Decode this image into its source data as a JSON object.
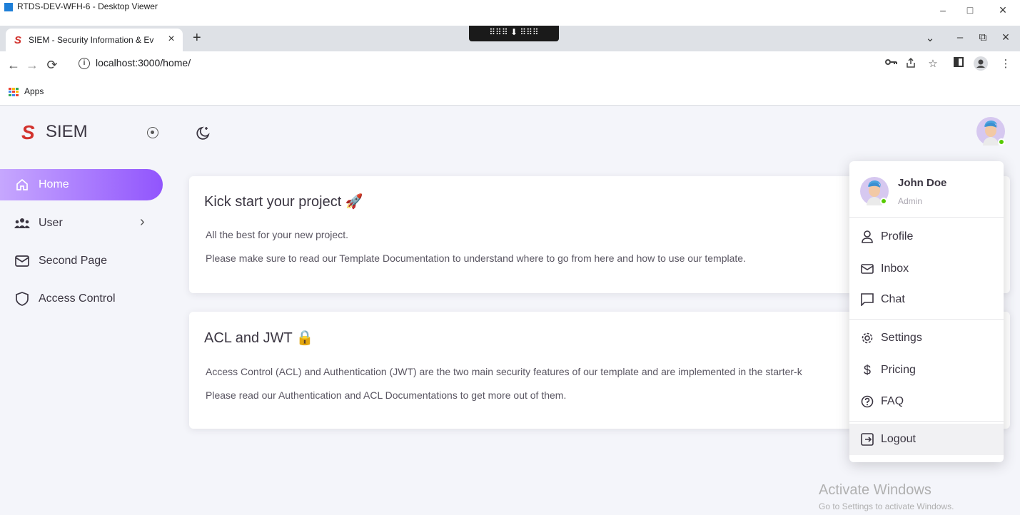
{
  "window": {
    "title": "RTDS-DEV-WFH-6 - Desktop Viewer",
    "minimize": "–",
    "maximize": "□",
    "close": "×"
  },
  "browser": {
    "tab_title": "SIEM - Security Information & Ev",
    "tab_close": "×",
    "new_tab": "+",
    "remote_bar": "⠿⠿⠿ ⬇ ⠿⠿⠿",
    "url": "localhost:3000/home/",
    "bookmark_apps": "Apps",
    "tab_dropdown": "⌄",
    "minimize": "–",
    "restore": "⧉",
    "close": "×"
  },
  "app": {
    "logo": "S",
    "name": "SIEM"
  },
  "sidebar": {
    "items": [
      {
        "label": "Home",
        "icon": "home-icon",
        "active": true
      },
      {
        "label": "User",
        "icon": "users-icon",
        "chevron": "›"
      },
      {
        "label": "Second Page",
        "icon": "mail-icon"
      },
      {
        "label": "Access Control",
        "icon": "shield-icon"
      }
    ]
  },
  "cards": [
    {
      "title": "Kick start your project 🚀",
      "lines": [
        "All the best for your new project.",
        "Please make sure to read our Template Documentation to understand where to go from here and how to use our template."
      ]
    },
    {
      "title": "ACL and JWT 🔒",
      "lines": [
        "Access Control (ACL) and Authentication (JWT) are the two main security features of our template and are implemented in the starter-k",
        "Please read our Authentication and ACL Documentations to get more out of them."
      ]
    }
  ],
  "user_menu": {
    "name": "John Doe",
    "role": "Admin",
    "items": [
      {
        "label": "Profile",
        "icon": "user-icon"
      },
      {
        "label": "Inbox",
        "icon": "mail-icon"
      },
      {
        "label": "Chat",
        "icon": "chat-icon"
      },
      {
        "label": "Settings",
        "icon": "gear-icon"
      },
      {
        "label": "Pricing",
        "icon": "dollar-icon"
      },
      {
        "label": "FAQ",
        "icon": "help-icon"
      },
      {
        "label": "Logout",
        "icon": "logout-icon"
      }
    ]
  },
  "watermark": {
    "title": "Activate Windows",
    "subtitle": "Go to Settings to activate Windows."
  },
  "colors": {
    "primary": "#9155fd",
    "online": "#56ca00",
    "brand_red": "#d2322d"
  }
}
